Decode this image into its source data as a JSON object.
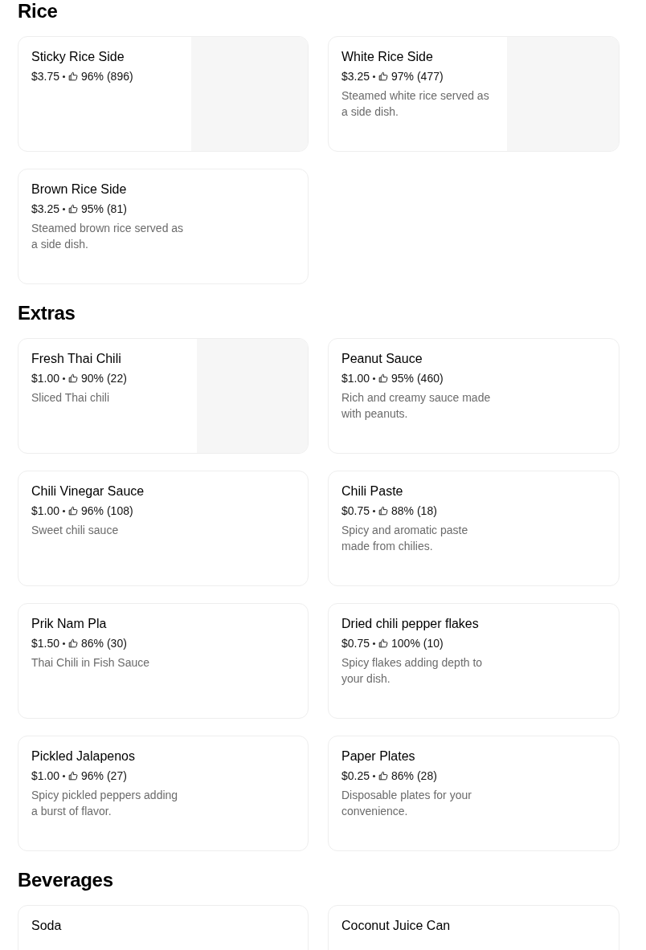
{
  "sections": [
    {
      "title": "Rice",
      "items": [
        {
          "name": "Sticky Rice Side",
          "price": "$3.75",
          "rating": "96% (896)",
          "image": true
        },
        {
          "name": "White Rice Side",
          "price": "$3.25",
          "rating": "97% (477)",
          "description": "Steamed white rice served as a side dish.",
          "image": true
        },
        {
          "name": "Brown Rice Side",
          "price": "$3.25",
          "rating": "95% (81)",
          "description": "Steamed brown rice served as a side dish.",
          "image": false
        }
      ]
    },
    {
      "title": "Extras",
      "items": [
        {
          "name": "Fresh Thai Chili",
          "price": "$1.00",
          "rating": "90% (22)",
          "description": "Sliced Thai chili",
          "image": true
        },
        {
          "name": "Peanut Sauce",
          "price": "$1.00",
          "rating": "95% (460)",
          "description": "Rich and creamy sauce made with peanuts.",
          "image": false
        },
        {
          "name": "Chili Vinegar Sauce",
          "price": "$1.00",
          "rating": "96% (108)",
          "description": "Sweet chili sauce",
          "image": false
        },
        {
          "name": "Chili Paste",
          "price": "$0.75",
          "rating": "88% (18)",
          "description": "Spicy and aromatic paste made from chilies.",
          "image": false
        },
        {
          "name": "Prik Nam Pla",
          "price": "$1.50",
          "rating": "86% (30)",
          "description": "Thai Chili in Fish Sauce",
          "image": false
        },
        {
          "name": "Dried chili pepper flakes",
          "price": "$0.75",
          "rating": "100% (10)",
          "description": "Spicy flakes adding depth to your dish.",
          "image": false
        },
        {
          "name": "Pickled Jalapenos",
          "price": "$1.00",
          "rating": "96% (27)",
          "description": "Spicy pickled peppers adding a burst of flavor.",
          "image": false
        },
        {
          "name": "Paper Plates",
          "price": "$0.25",
          "rating": "86% (28)",
          "description": "Disposable plates for your convenience.",
          "image": false
        }
      ]
    },
    {
      "title": "Beverages",
      "items": [
        {
          "name": "Soda",
          "image": false
        },
        {
          "name": "Coconut Juice Can",
          "image": false
        }
      ]
    }
  ]
}
